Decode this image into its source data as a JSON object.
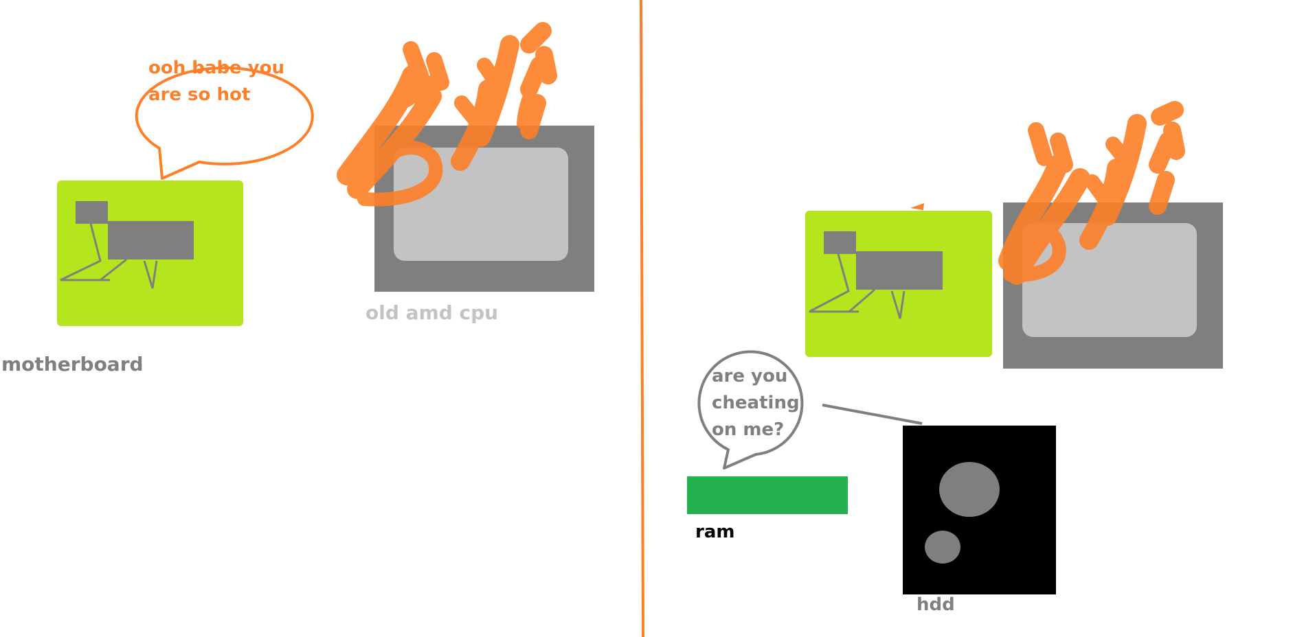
{
  "labels": {
    "motherboard": "motherboard",
    "cpu": "old amd cpu",
    "ram": "ram",
    "hdd": "hdd"
  },
  "bubbles": {
    "motherboard_line1": "ooh babe you",
    "motherboard_line2": "are so hot",
    "hdd_line1": "are you",
    "hdd_line2": "cheating",
    "hdd_line3": "on me?"
  },
  "colors": {
    "orange": "#fd7f28",
    "lime": "#b5e61d",
    "gray": "#7f7f7f",
    "light_gray": "#c3c3c3",
    "green": "#22b14c",
    "black": "#000000"
  }
}
